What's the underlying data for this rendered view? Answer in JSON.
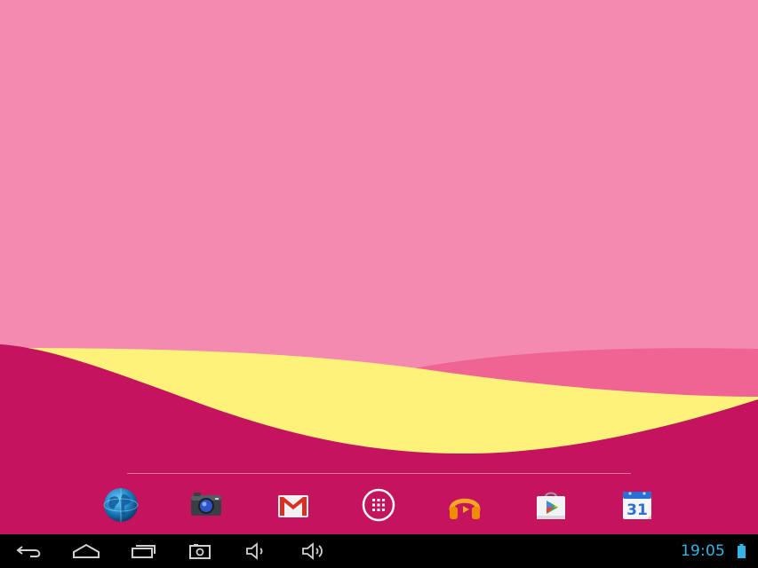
{
  "status_bar": {
    "time": "19:05"
  },
  "dock": {
    "apps": [
      {
        "id": "browser",
        "icon": "globe-icon"
      },
      {
        "id": "camera",
        "icon": "camera-icon"
      },
      {
        "id": "gmail",
        "icon": "gmail-icon"
      },
      {
        "id": "all-apps",
        "icon": "app-drawer-icon"
      },
      {
        "id": "play-music",
        "icon": "headphones-icon"
      },
      {
        "id": "play-store",
        "icon": "play-store-icon"
      },
      {
        "id": "calendar",
        "icon": "calendar-icon",
        "date_label": "31"
      }
    ]
  },
  "navigation": {
    "buttons": [
      "back-icon",
      "home-icon",
      "recent-apps-icon",
      "screenshot-icon",
      "volume-down-icon",
      "volume-up-icon"
    ]
  },
  "colors": {
    "wallpaper_sky": "#f48aaf",
    "wallpaper_magenta": "#c4145e",
    "wallpaper_yellow": "#fff27a",
    "wallpaper_pink_band": "#f06494",
    "nav_bar": "#000000",
    "clock_color": "#33b5e5"
  }
}
